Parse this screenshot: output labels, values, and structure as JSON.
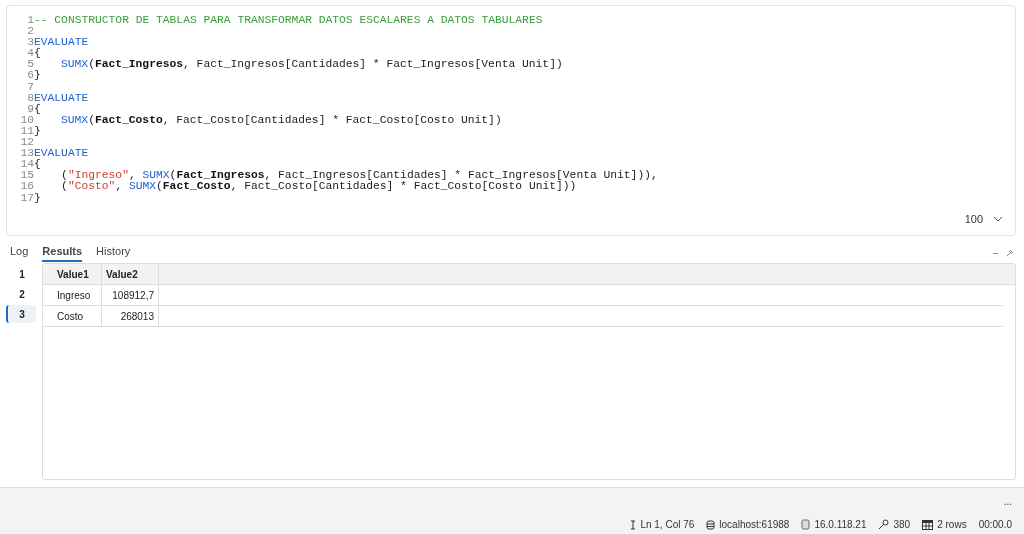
{
  "editor": {
    "lines": [
      {
        "number": "1",
        "tokens": [
          {
            "kind": "comment",
            "text": "-- CONSTRUCTOR DE TABLAS PARA TRANSFORMAR DATOS ESCALARES A DATOS TABULARES"
          }
        ]
      },
      {
        "number": "2"
      },
      {
        "number": "3",
        "tokens": [
          {
            "kind": "keyword",
            "text": "EVALUATE"
          }
        ]
      },
      {
        "number": "4",
        "tokens": [
          {
            "kind": "plain",
            "text": "{"
          }
        ]
      },
      {
        "number": "5",
        "indented": true,
        "tokens": [
          {
            "kind": "keyword",
            "text": "SUMX"
          },
          {
            "kind": "plain",
            "text": "("
          },
          {
            "kind": "table",
            "text": "Fact_Ingresos"
          },
          {
            "kind": "plain",
            "text": ", Fact_Ingresos[Cantidades] * Fact_Ingresos[Venta Unit])"
          }
        ]
      },
      {
        "number": "6",
        "tokens": [
          {
            "kind": "plain",
            "text": "}"
          }
        ]
      },
      {
        "number": "7"
      },
      {
        "number": "8",
        "tokens": [
          {
            "kind": "keyword",
            "text": "EVALUATE"
          }
        ]
      },
      {
        "number": "9",
        "tokens": [
          {
            "kind": "plain",
            "text": "{"
          }
        ]
      },
      {
        "number": "10",
        "indented": true,
        "tokens": [
          {
            "kind": "keyword",
            "text": "SUMX"
          },
          {
            "kind": "plain",
            "text": "("
          },
          {
            "kind": "table",
            "text": "Fact_Costo"
          },
          {
            "kind": "plain",
            "text": ", Fact_Costo[Cantidades] * Fact_Costo[Costo Unit])"
          }
        ]
      },
      {
        "number": "11",
        "tokens": [
          {
            "kind": "plain",
            "text": "}"
          }
        ]
      },
      {
        "number": "12"
      },
      {
        "number": "13",
        "tokens": [
          {
            "kind": "keyword",
            "text": "EVALUATE"
          }
        ]
      },
      {
        "number": "14",
        "tokens": [
          {
            "kind": "plain",
            "text": "{"
          }
        ]
      },
      {
        "number": "15",
        "tokens": [
          {
            "kind": "plain",
            "text": "    ("
          },
          {
            "kind": "string",
            "text": "\"Ingreso\""
          },
          {
            "kind": "plain",
            "text": ", "
          },
          {
            "kind": "keyword",
            "text": "SUMX"
          },
          {
            "kind": "plain",
            "text": "("
          },
          {
            "kind": "table",
            "text": "Fact_Ingresos"
          },
          {
            "kind": "plain",
            "text": ", Fact_Ingresos[Cantidades] * Fact_Ingresos[Venta Unit])),"
          }
        ]
      },
      {
        "number": "16",
        "tokens": [
          {
            "kind": "plain",
            "text": "    ("
          },
          {
            "kind": "string",
            "text": "\"Costo\""
          },
          {
            "kind": "plain",
            "text": ", "
          },
          {
            "kind": "keyword",
            "text": "SUMX"
          },
          {
            "kind": "plain",
            "text": "("
          },
          {
            "kind": "table",
            "text": "Fact_Costo"
          },
          {
            "kind": "plain",
            "text": ", Fact_Costo[Cantidades] * Fact_Costo[Costo Unit]))"
          }
        ]
      },
      {
        "number": "17",
        "tokens": [
          {
            "kind": "plain",
            "text": "}"
          }
        ]
      }
    ],
    "zoom": "100"
  },
  "tabs": [
    {
      "label": "Log",
      "selected": false
    },
    {
      "label": "Results",
      "selected": true
    },
    {
      "label": "History",
      "selected": false
    }
  ],
  "result_sets": [
    {
      "label": "1",
      "selected": false
    },
    {
      "label": "2",
      "selected": false
    },
    {
      "label": "3",
      "selected": true
    }
  ],
  "table": {
    "columns": [
      "Value1",
      "Value2"
    ],
    "rows": [
      [
        "Ingreso",
        "108912,7"
      ],
      [
        "Costo",
        "268013"
      ]
    ]
  },
  "more": "...",
  "status_bar": [
    {
      "kind": "cursor",
      "text": "Ln 1, Col 76"
    },
    {
      "kind": "server",
      "text": "localhost:61988"
    },
    {
      "kind": "version",
      "text": "16.0.118.21"
    },
    {
      "kind": "spid",
      "text": "380"
    },
    {
      "kind": "rows",
      "text": "2 rows"
    },
    {
      "kind": "time",
      "text": "00:00.0"
    }
  ]
}
